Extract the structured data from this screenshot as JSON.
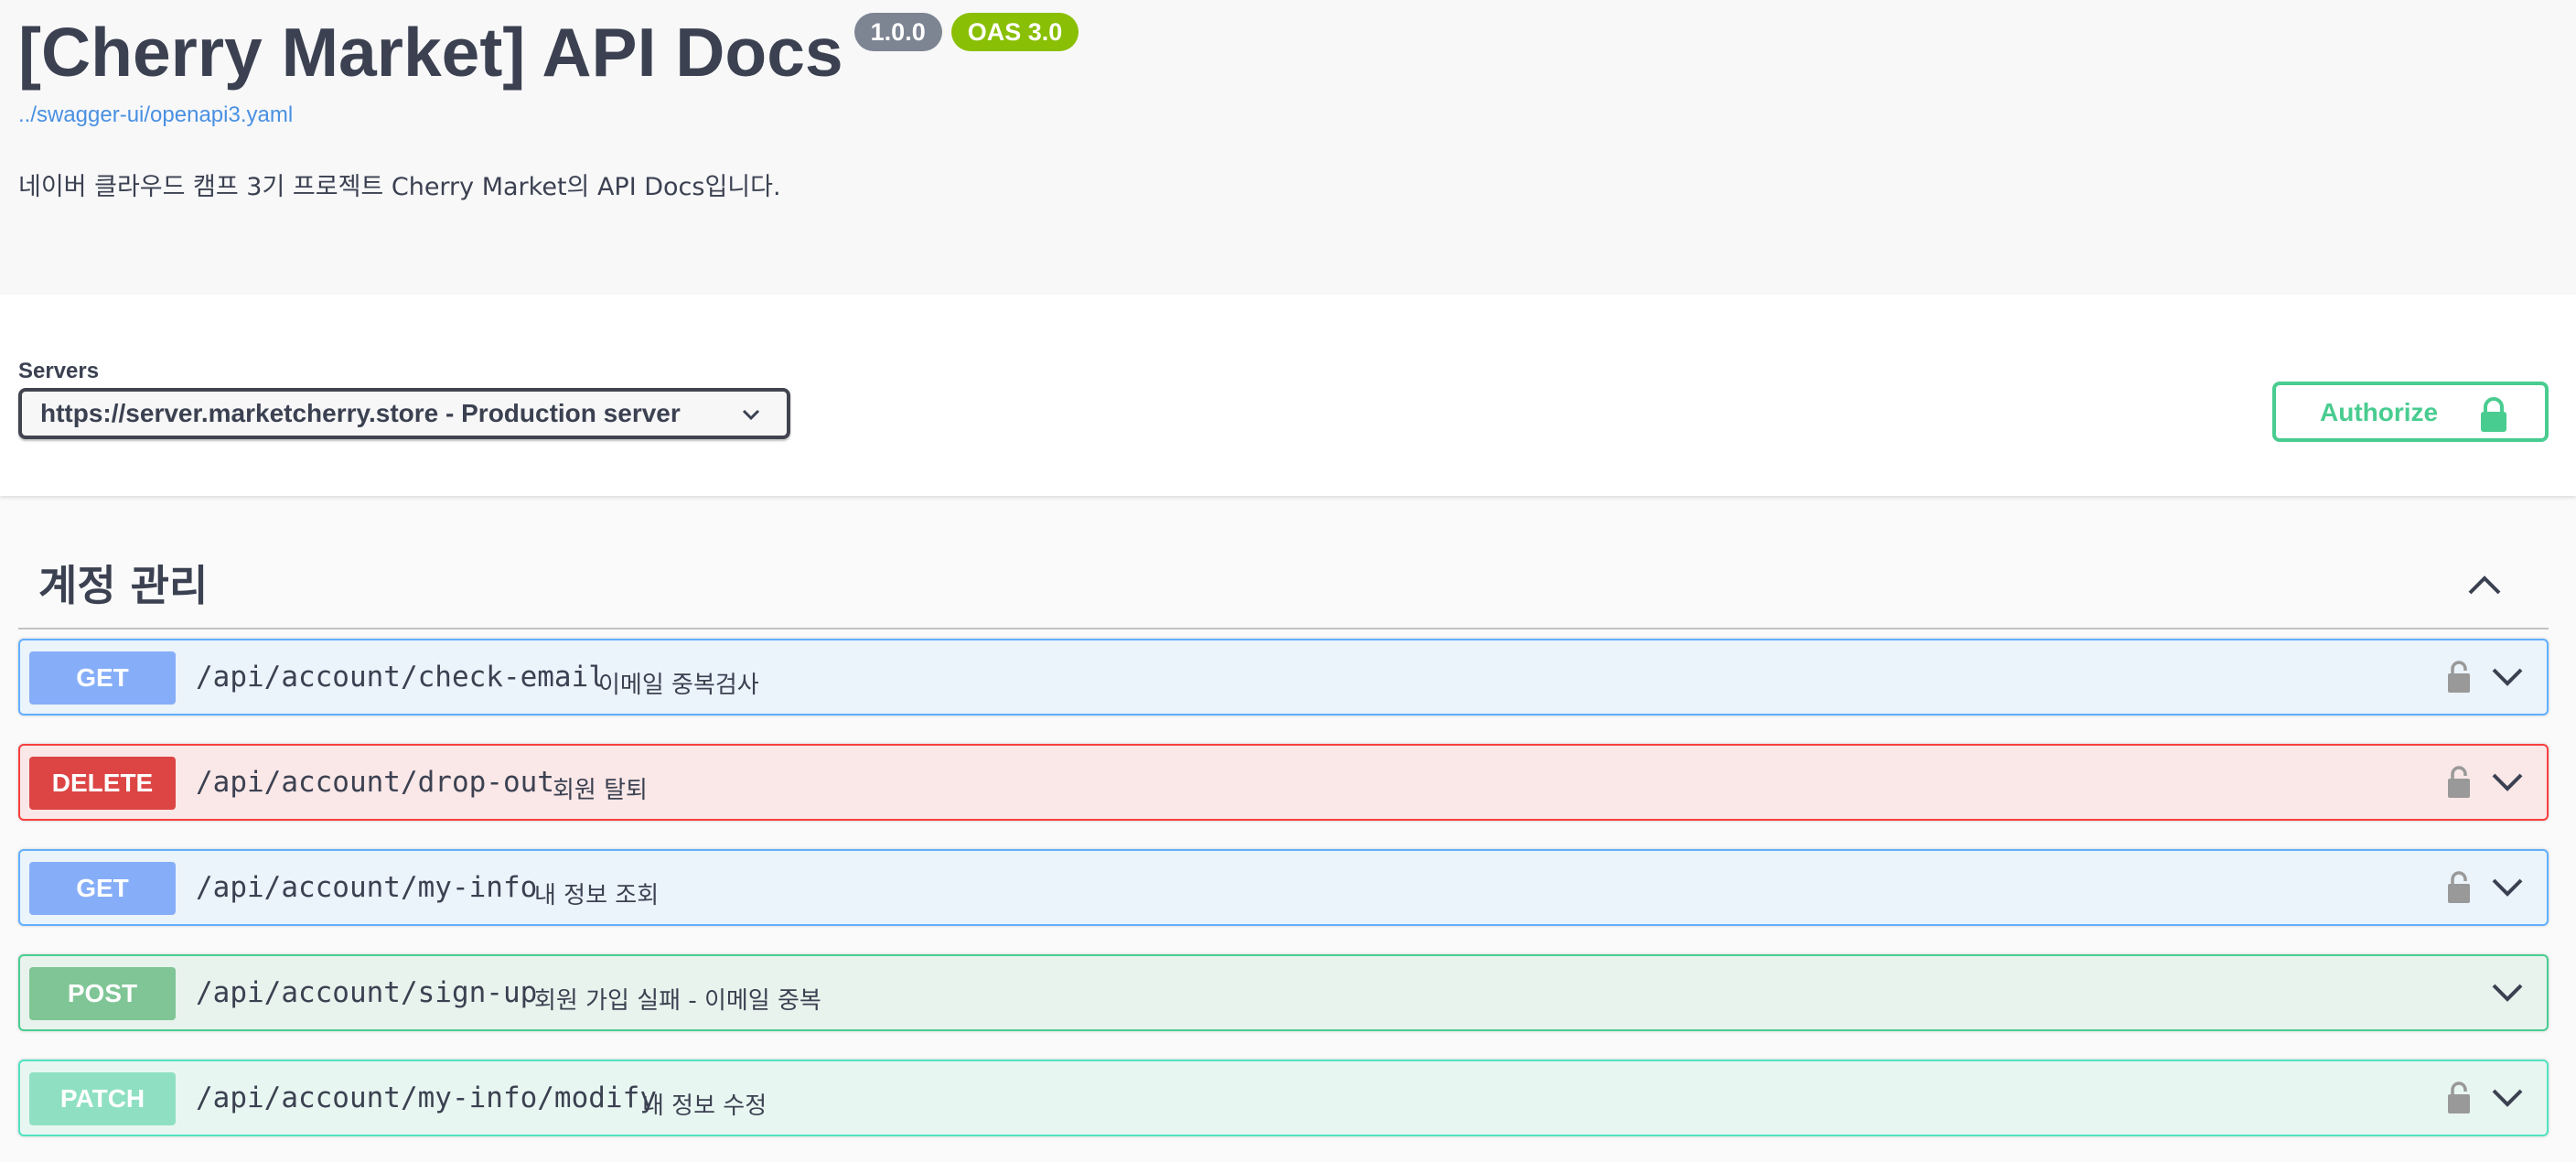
{
  "info": {
    "title": "[Cherry Market] API Docs",
    "version_badge": "1.0.0",
    "oas_badge": "OAS 3.0",
    "spec_link": "../swagger-ui/openapi3.yaml",
    "description": "네이버 클라우드 캠프 3기 프로젝트 Cherry Market의 API Docs입니다."
  },
  "servers": {
    "label": "Servers",
    "selected": "https://server.marketcherry.store - Production server"
  },
  "authorize": {
    "label": "Authorize"
  },
  "tag": {
    "title": "계정 관리"
  },
  "operations": [
    {
      "method": "GET",
      "path": "/api/account/check-email",
      "summary": "이메일 중복검사",
      "locked": true
    },
    {
      "method": "DELETE",
      "path": "/api/account/drop-out",
      "summary": "회원 탈퇴",
      "locked": true
    },
    {
      "method": "GET",
      "path": "/api/account/my-info",
      "summary": "내 정보 조회",
      "locked": true
    },
    {
      "method": "POST",
      "path": "/api/account/sign-up",
      "summary": "회원 가입 실패 - 이메일 중복",
      "locked": false
    },
    {
      "method": "PATCH",
      "path": "/api/account/my-info/modify",
      "summary": "내 정보 수정",
      "locked": true
    }
  ],
  "colors": {
    "get": "#61affe",
    "delete": "#f93e3e",
    "post": "#49cc90",
    "patch": "#50e3c2",
    "link": "#4990e2",
    "oas_badge": "#89bf04",
    "version_badge": "#7d8492"
  },
  "icons": {
    "server_dropdown": "chevron-down-icon",
    "authorize": "lock-icon",
    "tag_toggle": "chevron-up-icon",
    "operation_lock": "lock-icon",
    "operation_expand": "chevron-down-icon"
  }
}
